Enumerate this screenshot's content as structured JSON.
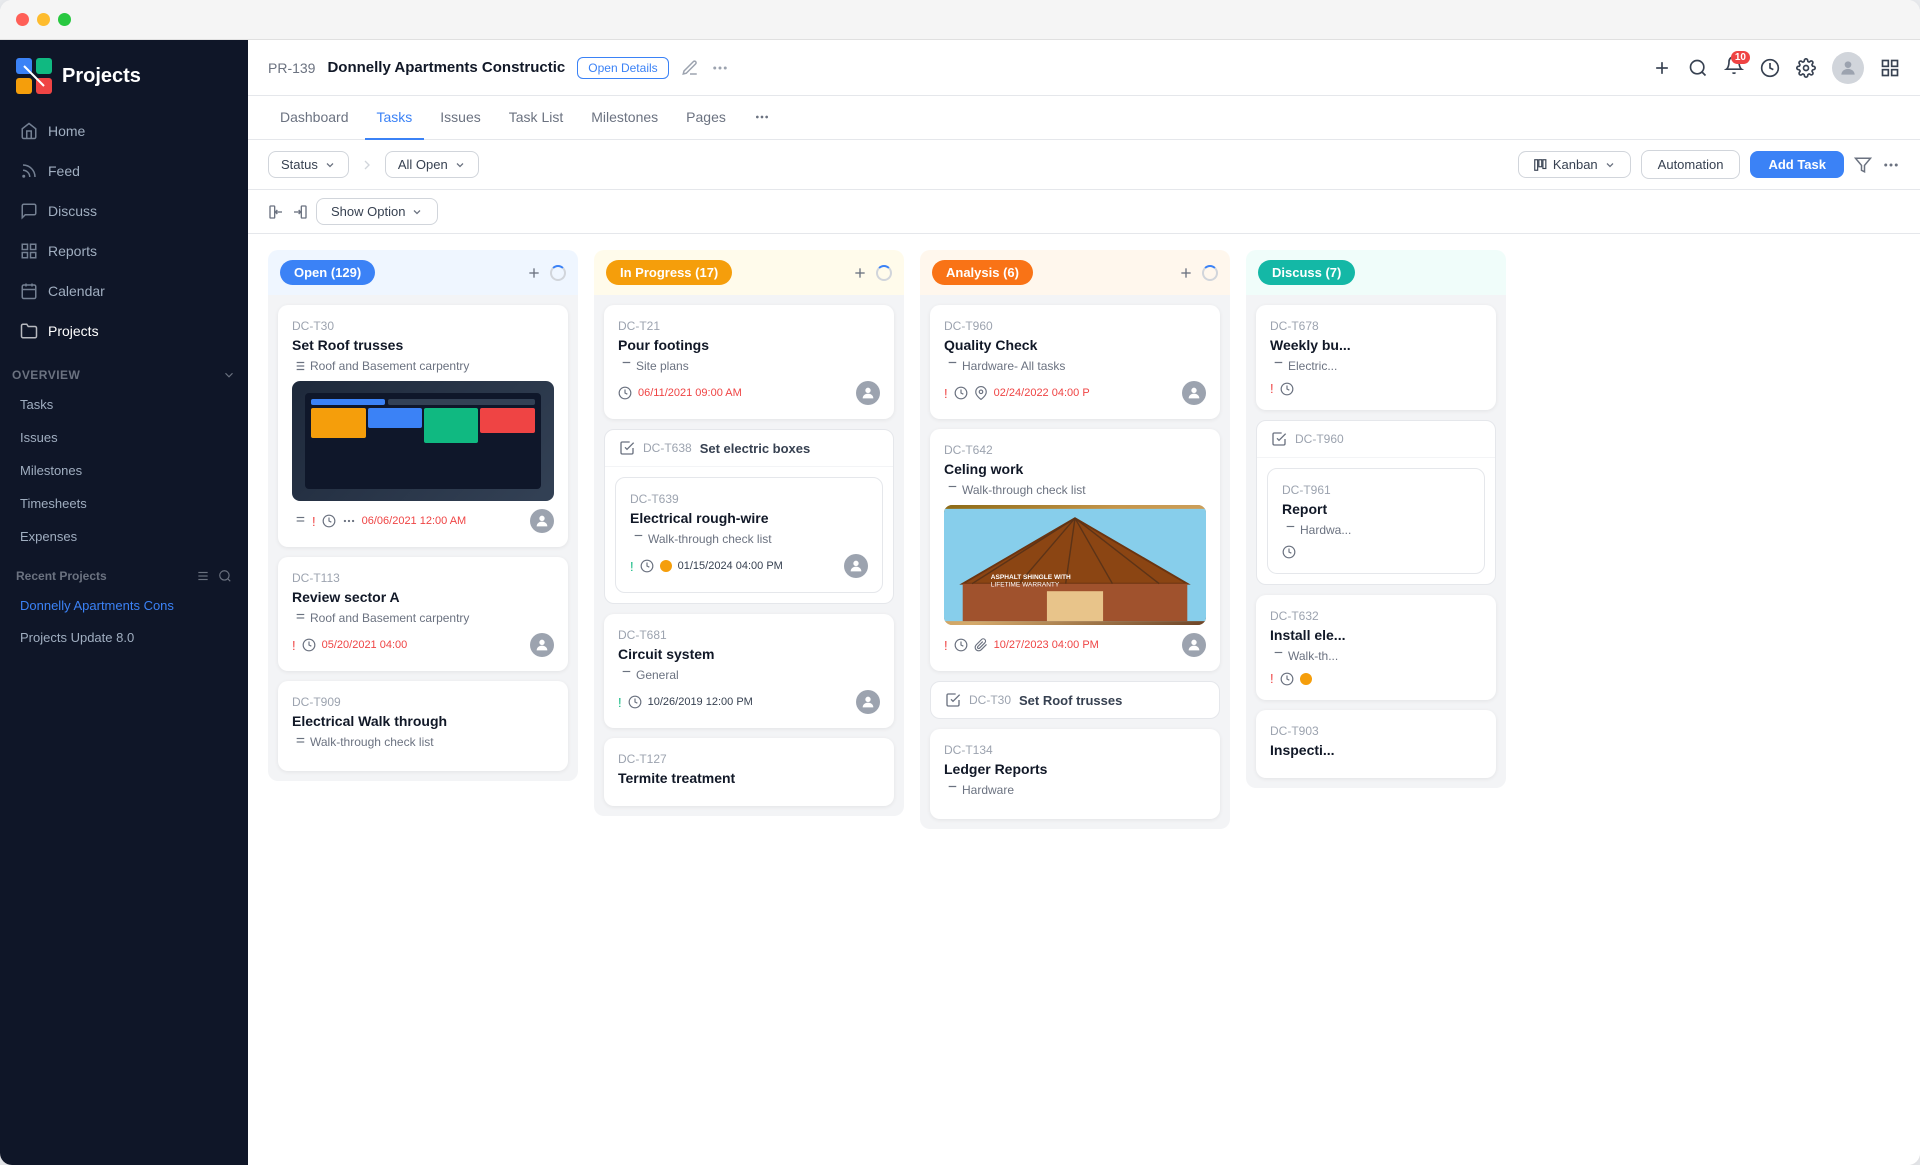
{
  "window": {
    "title": "Projects"
  },
  "titleBar": {
    "trafficLights": [
      "red",
      "yellow",
      "green"
    ]
  },
  "sidebar": {
    "logo": "Projects",
    "nav": [
      {
        "id": "home",
        "label": "Home",
        "icon": "home"
      },
      {
        "id": "feed",
        "label": "Feed",
        "icon": "feed"
      },
      {
        "id": "discuss",
        "label": "Discuss",
        "icon": "discuss"
      },
      {
        "id": "reports",
        "label": "Reports",
        "icon": "reports"
      },
      {
        "id": "calendar",
        "label": "Calendar",
        "icon": "calendar"
      },
      {
        "id": "projects",
        "label": "Projects",
        "icon": "projects"
      }
    ],
    "overview": {
      "label": "Overview",
      "items": [
        "Tasks",
        "Issues",
        "Milestones",
        "Timesheets",
        "Expenses"
      ]
    },
    "recentProjects": {
      "label": "Recent Projects",
      "items": [
        {
          "label": "Donnelly Apartments Cons",
          "active": true
        },
        {
          "label": "Projects Update 8.0",
          "active": false
        }
      ]
    }
  },
  "topbar": {
    "projectId": "PR-139",
    "projectName": "Donnelly Apartments Constructic",
    "openDetailsLabel": "Open Details",
    "icons": [
      "pencil",
      "more"
    ],
    "rightIcons": [
      "plus",
      "search",
      "bell",
      "clock",
      "gear",
      "grid"
    ],
    "notifCount": "10"
  },
  "tabs": {
    "items": [
      "Dashboard",
      "Tasks",
      "Issues",
      "Task List",
      "Milestones",
      "Pages",
      "..."
    ],
    "active": "Tasks"
  },
  "toolbar": {
    "statusLabel": "Status",
    "allOpenLabel": "All Open",
    "kanbanLabel": "Kanban",
    "automationLabel": "Automation",
    "addTaskLabel": "Add Task"
  },
  "showOption": {
    "label": "Show Option"
  },
  "columns": [
    {
      "id": "open",
      "label": "Open (129)",
      "color": "#3b82f6",
      "count": 129,
      "cards": [
        {
          "id": "DC-T30",
          "title": "Set Roof trusses",
          "sub": "Roof and Basement carpentry",
          "hasImage": true,
          "date": "06/06/2021 12:00 AM",
          "dateColor": "red",
          "hasAvatar": true,
          "hasPriorityRed": true,
          "hasTimer": true,
          "hasMenu": true
        },
        {
          "id": "DC-T113",
          "title": "Review sector A",
          "sub": "Roof and Basement carpentry",
          "hasImage": false,
          "date": "05/20/2021 04:00",
          "dateColor": "red",
          "hasAvatar": true,
          "hasPriorityRed": true,
          "hasTimer": true
        },
        {
          "id": "DC-T909",
          "title": "Electrical Walk through",
          "sub": "Walk-through check list",
          "hasImage": false,
          "date": "",
          "dateColor": "",
          "hasAvatar": false,
          "hasPriorityRed": false,
          "hasTimer": false
        }
      ]
    },
    {
      "id": "in-progress",
      "label": "In Progress (17)",
      "color": "#f59e0b",
      "count": 17,
      "cards": [
        {
          "id": "DC-T21",
          "title": "Pour footings",
          "sub": "Site plans",
          "hasImage": false,
          "date": "06/11/2021 09:00 AM",
          "dateColor": "red",
          "hasAvatar": true,
          "hasPriorityRed": false,
          "hasTimer": true
        },
        {
          "id": "DC-T638",
          "groupLabel": "Set electric boxes",
          "isGroup": true,
          "subCards": [
            {
              "id": "DC-T639",
              "title": "Electrical rough-wire",
              "sub": "Walk-through check list",
              "date": "01/15/2024 04:00 PM",
              "dateColor": "normal",
              "hasAvatar": true,
              "hasPriorityGreen": true,
              "hasTimer": true,
              "hasDotYellow": true
            }
          ]
        },
        {
          "id": "DC-T681",
          "title": "Circuit system",
          "sub": "General",
          "hasImage": false,
          "date": "10/26/2019 12:00 PM",
          "dateColor": "normal",
          "hasAvatar": true,
          "hasPriorityGreen": true,
          "hasTimer": true
        },
        {
          "id": "DC-T127",
          "title": "Termite treatment",
          "sub": "",
          "hasImage": false,
          "date": "",
          "dateColor": "",
          "hasAvatar": false,
          "partial": true
        }
      ]
    },
    {
      "id": "analysis",
      "label": "Analysis (6)",
      "color": "#f97316",
      "count": 6,
      "cards": [
        {
          "id": "DC-T960",
          "title": "Quality Check",
          "sub": "Hardware- All tasks",
          "hasImage": false,
          "date": "02/24/2022 04:00 P",
          "dateColor": "red",
          "hasAvatar": true,
          "hasPriorityRed": true,
          "hasTimer": true,
          "hasPin": true
        },
        {
          "id": "DC-T642",
          "title": "Celing work",
          "sub": "Walk-through check list",
          "hasImage": true,
          "date": "10/27/2023 04:00 PM",
          "dateColor": "red",
          "hasAvatar": true,
          "hasPriorityRed": true,
          "hasTimer": true,
          "hasClip": true
        },
        {
          "id": "DC-T30",
          "groupLabel": "Set Roof trusses",
          "isGroup": true,
          "subCards": []
        },
        {
          "id": "DC-T134",
          "title": "Ledger Reports",
          "sub": "Hardware",
          "partial": true
        }
      ]
    },
    {
      "id": "discuss",
      "label": "Discuss (7)",
      "color": "#14b8a6",
      "count": 7,
      "cards": [
        {
          "id": "DC-T678",
          "title": "Weekly bu...",
          "sub": "Electric...",
          "hasPriorityRed": true,
          "hasTimer": true,
          "partial": true
        },
        {
          "id": "DC-T960",
          "groupLabel": "",
          "isGroup": true,
          "subCards": [
            {
              "id": "DC-T961",
              "title": "Report",
              "sub": "Hardwa...",
              "hasTimer": true
            }
          ]
        },
        {
          "id": "DC-T632",
          "title": "Install ele...",
          "sub": "Walk-th...",
          "hasPriorityRed": true,
          "hasTimer": true,
          "hasDotYellow": true,
          "partial": true
        },
        {
          "id": "DC-T903",
          "title": "Inspecti...",
          "sub": "",
          "partial": true
        }
      ]
    }
  ]
}
